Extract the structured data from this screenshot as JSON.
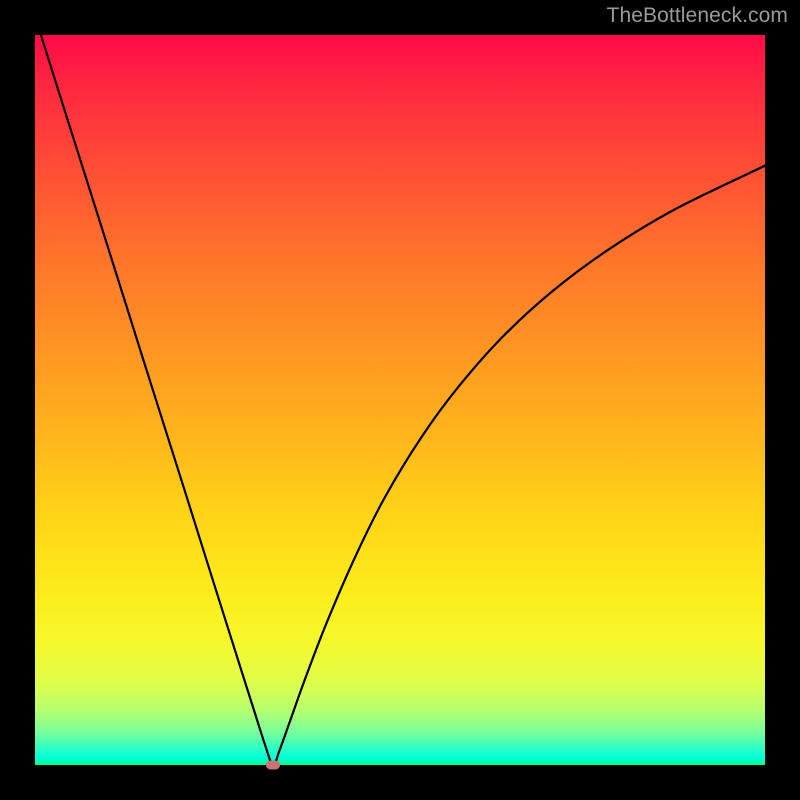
{
  "watermark": "TheBottleneck.com",
  "chart_data": {
    "type": "line",
    "title": "",
    "xlabel": "",
    "ylabel": "",
    "xlim": [
      0,
      100
    ],
    "ylim": [
      0,
      100
    ],
    "grid": false,
    "legend": false,
    "background_gradient": {
      "top": "#ff0b47",
      "mid": "#ffcc18",
      "bottom": "#00ff8e"
    },
    "series": [
      {
        "name": "bottleneck-curve",
        "color": "#000000",
        "x": [
          0.5,
          5,
          10,
          15,
          20,
          25,
          28,
          30,
          31.5,
          32.6,
          33.5,
          35,
          37,
          40,
          44,
          48,
          53,
          58,
          64,
          71,
          79,
          88,
          100
        ],
        "y": [
          101,
          86.7,
          70.9,
          55.0,
          39.2,
          23.3,
          13.8,
          7.5,
          2.8,
          0.0,
          2.0,
          6.2,
          11.8,
          19.6,
          28.8,
          36.8,
          45.0,
          51.8,
          58.6,
          65.0,
          70.9,
          76.3,
          82.1
        ]
      }
    ],
    "marker": {
      "x": 32.6,
      "y": 0.0,
      "color": "#cb7277"
    },
    "minimum": {
      "x": 32.6,
      "y": 0.0
    }
  }
}
